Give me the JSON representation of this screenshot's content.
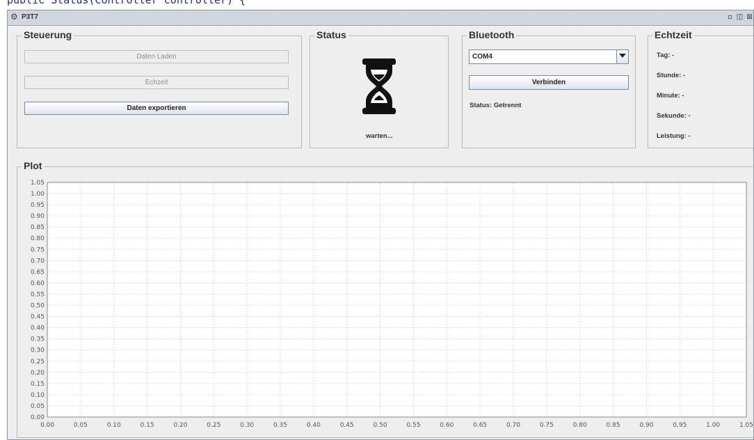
{
  "background_code": "public Status(Controller controller) {",
  "window": {
    "title": "P3T7",
    "icon": "gear-icon",
    "buttons": [
      "minimize-icon",
      "maximize-icon",
      "close-icon"
    ]
  },
  "steuerung": {
    "title": "Steuerung",
    "daten_laden_label": "Daten Laden",
    "echtzeit_label": "Echzeit",
    "export_label": "Daten exportieren"
  },
  "status": {
    "title": "Status",
    "icon": "hourglass-icon",
    "text": "warten..."
  },
  "bluetooth": {
    "title": "Bluetooth",
    "port": "COM4",
    "connect_label": "Verbinden",
    "status_text": "Status: Getrennt"
  },
  "echtzeit": {
    "title": "Echtzeit",
    "tag": "Tag: -",
    "stunde": "Stunde: -",
    "minute": "Minute: -",
    "sekunde": "Sekunde: -",
    "leistung": "Leistung: -"
  },
  "plot": {
    "title": "Plot"
  },
  "chart_data": {
    "type": "line",
    "series": [],
    "xlim": [
      0.0,
      1.05
    ],
    "ylim": [
      0.0,
      1.05
    ],
    "xticks": [
      "0.00",
      "0.05",
      "0.10",
      "0.15",
      "0.20",
      "0.25",
      "0.30",
      "0.35",
      "0.40",
      "0.45",
      "0.50",
      "0.55",
      "0.60",
      "0.65",
      "0.70",
      "0.75",
      "0.80",
      "0.85",
      "0.90",
      "0.95",
      "1.00",
      "1.05"
    ],
    "yticks": [
      "0.00",
      "0.05",
      "0.10",
      "0.15",
      "0.20",
      "0.25",
      "0.30",
      "0.35",
      "0.40",
      "0.45",
      "0.50",
      "0.55",
      "0.60",
      "0.65",
      "0.70",
      "0.75",
      "0.80",
      "0.85",
      "0.90",
      "0.95",
      "1.00",
      "1.05"
    ],
    "grid": true,
    "colors": {
      "grid": "#d0d0d0",
      "frame": "#888888",
      "plot_bg": "#ffffff"
    }
  }
}
